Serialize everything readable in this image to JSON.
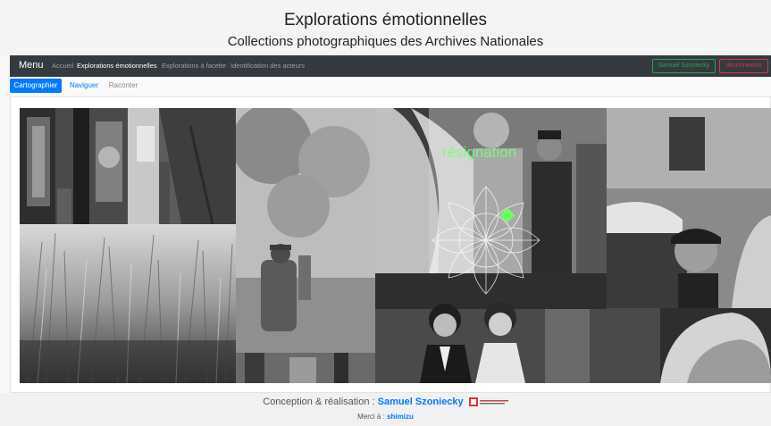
{
  "header": {
    "title": "Explorations émotionnelles",
    "subtitle": "Collections photographiques des Archives Nationales"
  },
  "navbar": {
    "brand": "Menu",
    "links": [
      "Accueil",
      "Explorations émotionnelles",
      "Explorations à facette",
      "Identification des acteurs"
    ],
    "active_link": "Explorations émotionnelles",
    "user_button": "Samuel Szoniecky",
    "logout_button": "déconnexion"
  },
  "subnav": {
    "tabs": [
      "Cartographier",
      "Naviguer",
      "Raconter"
    ],
    "active_tab": "Cartographier"
  },
  "mosaic": {
    "emotion_label": "résignation",
    "emotion_color": "#7CFC7C",
    "marker_color": "#66ff66"
  },
  "footer": {
    "credit_prefix": "Conception & réalisation :",
    "author": "Samuel Szoniecky",
    "thanks_prefix": "Merci à :",
    "thanks_name": "shimizu"
  },
  "colors": {
    "navbar_bg": "#343a40",
    "primary": "#007bff",
    "success": "#28a745",
    "danger": "#dc3545"
  }
}
